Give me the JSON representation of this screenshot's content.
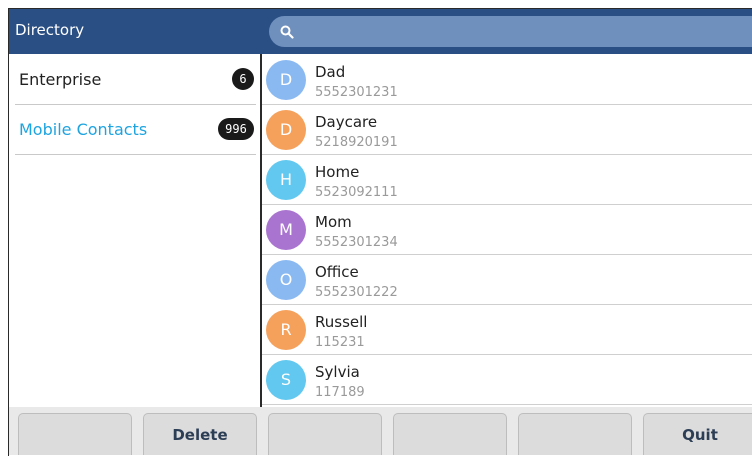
{
  "header": {
    "title": "Directory"
  },
  "search": {
    "icon": "search-icon"
  },
  "sidebar": {
    "items": [
      {
        "label": "Enterprise",
        "count": "6"
      },
      {
        "label": "Mobile Contacts",
        "count": "996"
      }
    ]
  },
  "contacts": [
    {
      "initial": "D",
      "name": "Dad",
      "number": "5552301231",
      "color": "#8ab9f1"
    },
    {
      "initial": "D",
      "name": "Daycare",
      "number": "5218920191",
      "color": "#f5a15c"
    },
    {
      "initial": "H",
      "name": "Home",
      "number": "5523092111",
      "color": "#62c8f0"
    },
    {
      "initial": "M",
      "name": "Mom",
      "number": "5552301234",
      "color": "#a974d0"
    },
    {
      "initial": "O",
      "name": "Office",
      "number": "5552301222",
      "color": "#8ab9f1"
    },
    {
      "initial": "R",
      "name": "Russell",
      "number": "115231",
      "color": "#f5a15c"
    },
    {
      "initial": "S",
      "name": "Sylvia",
      "number": "117189",
      "color": "#62c8f0"
    }
  ],
  "softkeys": [
    "",
    "Delete",
    "",
    "",
    "",
    "Quit"
  ],
  "colors": {
    "header": "#2a4f84",
    "search": "#6f8fbd",
    "active": "#1ea4e0"
  }
}
